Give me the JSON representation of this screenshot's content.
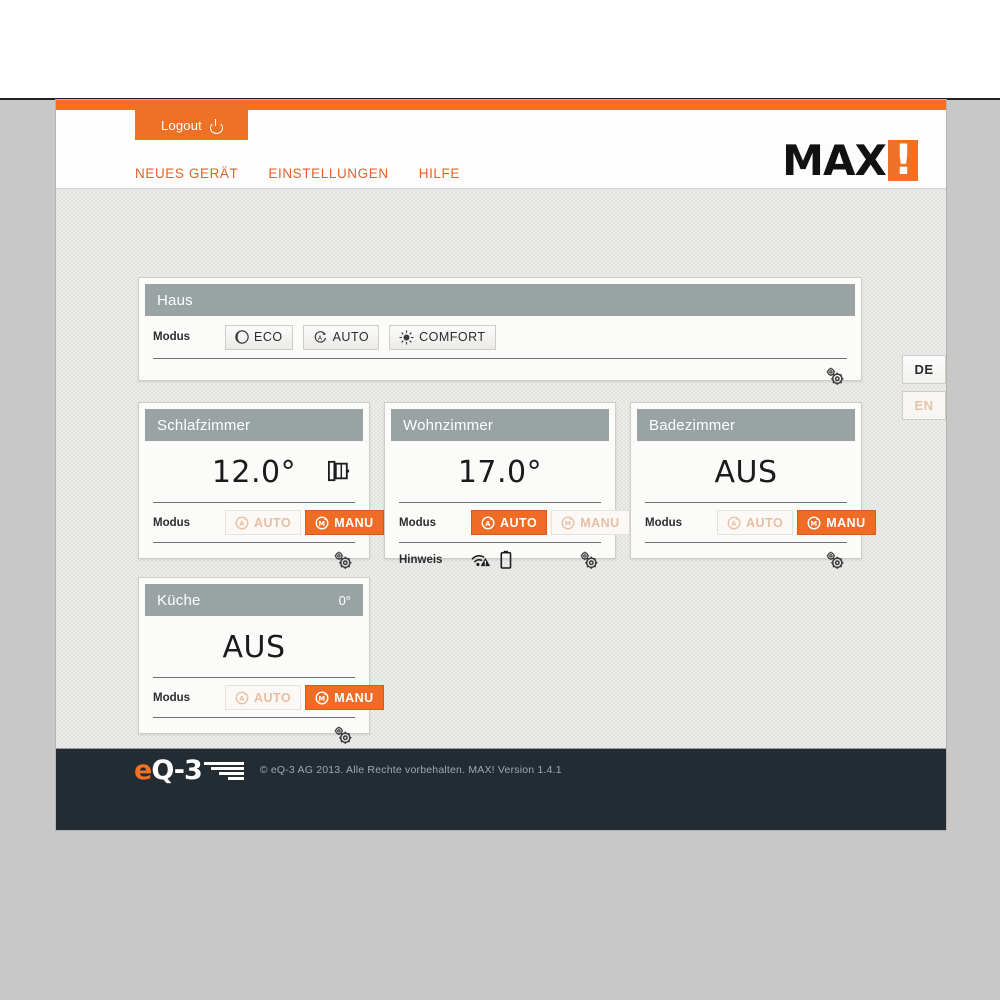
{
  "browser": {
    "logout_label": "Logout",
    "logout_icon": "power-icon"
  },
  "nav": {
    "items": [
      {
        "label": "NEUES GERÄT"
      },
      {
        "label": "EINSTELLUNGEN"
      },
      {
        "label": "HILFE"
      }
    ]
  },
  "brand": {
    "text": "MAX",
    "bang": "!"
  },
  "language": {
    "active": "DE",
    "inactive": "EN"
  },
  "house": {
    "title": "Haus",
    "mode_label": "Modus",
    "modes": [
      {
        "label": "ECO",
        "icon": "moon-icon",
        "state": "idle"
      },
      {
        "label": "AUTO",
        "icon": "auto-circle-icon",
        "state": "idle"
      },
      {
        "label": "COMFORT",
        "icon": "sun-icon",
        "state": "idle"
      }
    ],
    "settings_icon": "gears-icon"
  },
  "rooms": [
    {
      "title": "Schlafzimmer",
      "header_value": "",
      "value": "12.0°",
      "status_icon": "open-window-icon",
      "mode_label": "Modus",
      "modes": [
        {
          "label": "AUTO",
          "icon": "auto-circle-icon",
          "state": "off"
        },
        {
          "label": "MANU",
          "icon": "manu-circle-icon",
          "state": "on"
        }
      ],
      "hint_label": "",
      "hints": [],
      "settings_icon": "gears-icon"
    },
    {
      "title": "Wohnzimmer",
      "header_value": "",
      "value": "17.0°",
      "status_icon": "",
      "mode_label": "Modus",
      "modes": [
        {
          "label": "AUTO",
          "icon": "auto-circle-icon",
          "state": "on"
        },
        {
          "label": "MANU",
          "icon": "manu-circle-icon",
          "state": "off"
        }
      ],
      "hint_label": "Hinweis",
      "hints": [
        {
          "icon": "signal-warning-icon"
        },
        {
          "icon": "battery-icon"
        }
      ],
      "settings_icon": "gears-icon"
    },
    {
      "title": "Badezimmer",
      "header_value": "",
      "value": "AUS",
      "status_icon": "",
      "mode_label": "Modus",
      "modes": [
        {
          "label": "AUTO",
          "icon": "auto-circle-icon",
          "state": "off"
        },
        {
          "label": "MANU",
          "icon": "manu-circle-icon",
          "state": "on"
        }
      ],
      "hint_label": "",
      "hints": [],
      "settings_icon": "gears-icon"
    },
    {
      "title": "Küche",
      "header_value": "0°",
      "value": "AUS",
      "status_icon": "",
      "mode_label": "Modus",
      "modes": [
        {
          "label": "AUTO",
          "icon": "auto-circle-icon",
          "state": "off"
        },
        {
          "label": "MANU",
          "icon": "manu-circle-icon",
          "state": "on"
        }
      ],
      "hint_label": "",
      "hints": [],
      "settings_icon": "gears-icon"
    }
  ],
  "footer": {
    "logo_e": "e",
    "logo_q3": "Q-3",
    "copyright": "© eQ-3 AG 2013. Alle Rechte vorbehalten. MAX! Version 1.4.1"
  },
  "colors": {
    "accent": "#ef7125",
    "panel_header": "#9aa3a3",
    "footer_bg": "#232b33",
    "desktop": "#c8c8c8"
  }
}
